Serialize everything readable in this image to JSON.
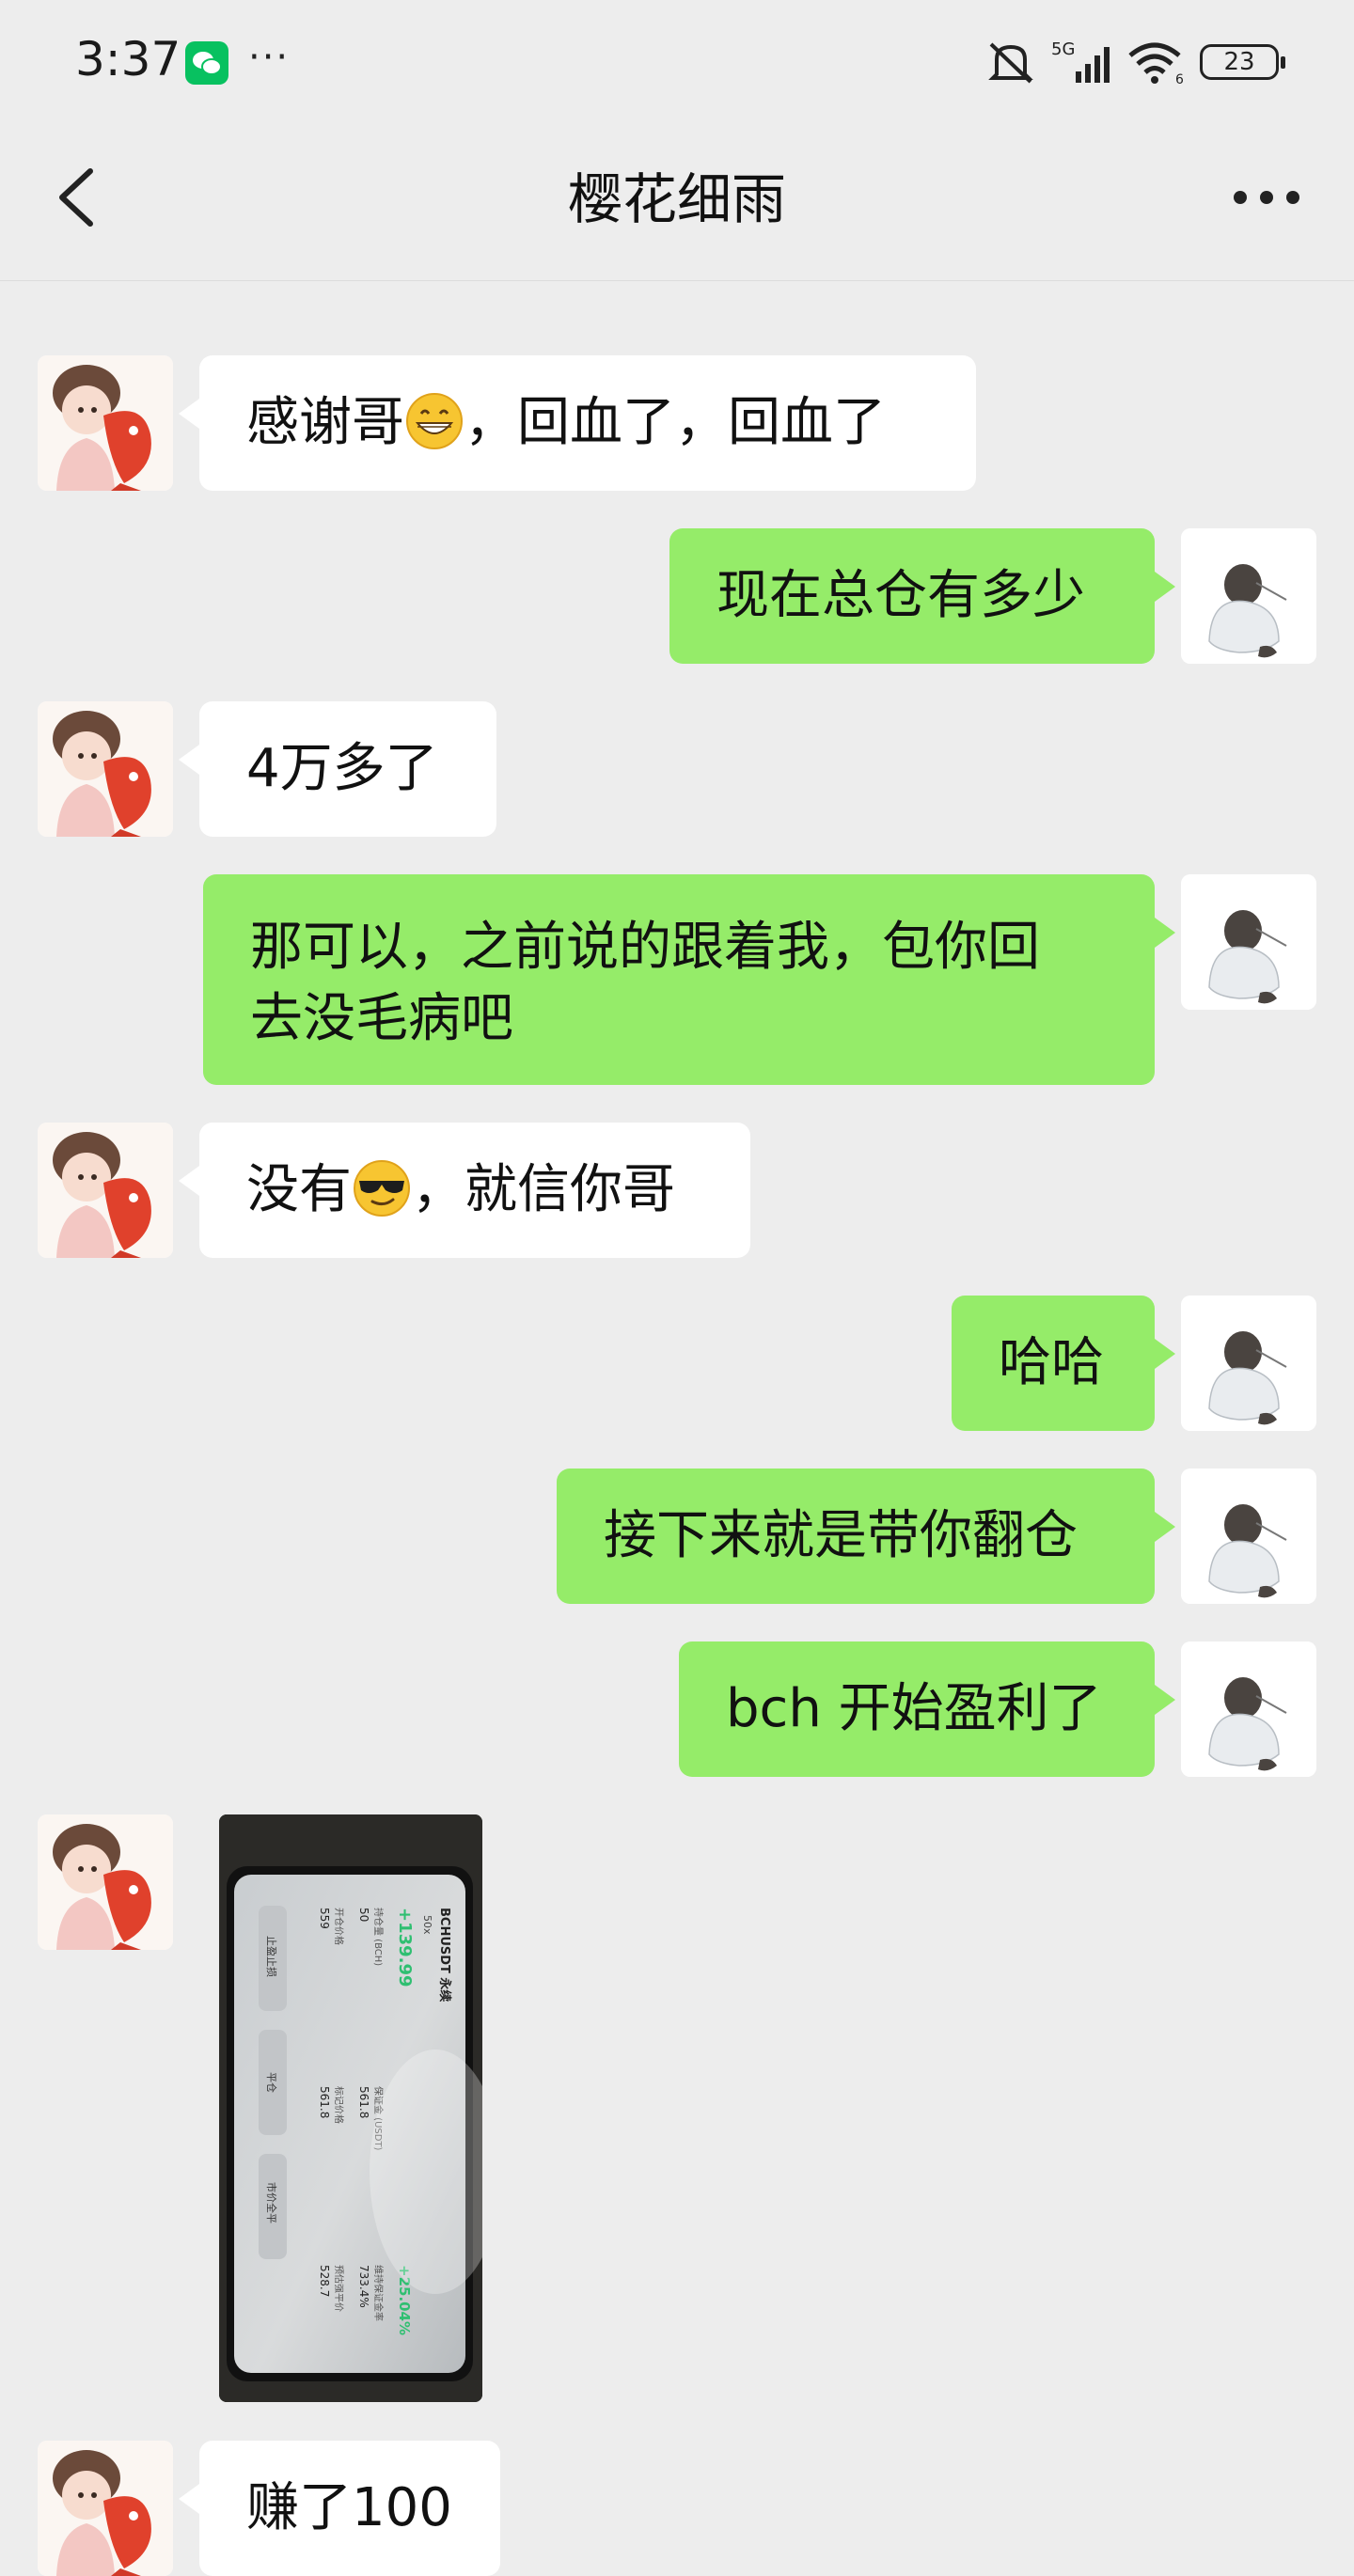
{
  "status": {
    "time": "3:37",
    "dots": "···",
    "network": "5G",
    "wifi_sub": "6",
    "battery": "23"
  },
  "header": {
    "title": "樱花细雨"
  },
  "messages": [
    {
      "side": "left",
      "text_a": "感谢哥",
      "text_b": "，回血了，回血了"
    },
    {
      "side": "right",
      "text": "现在总仓有多少"
    },
    {
      "side": "left",
      "text": "4万多了"
    },
    {
      "side": "right",
      "line1": "那可以，之前说的跟着我，包你回",
      "line2": "去没毛病吧"
    },
    {
      "side": "left",
      "text_a": "没有",
      "text_b": "，就信你哥"
    },
    {
      "side": "right",
      "text": "哈哈"
    },
    {
      "side": "right",
      "text": "接下来就是带你翻仓"
    },
    {
      "side": "right",
      "text": "bch 开始盈利了"
    },
    {
      "side": "left",
      "type": "image"
    },
    {
      "side": "left",
      "text": "赚了100"
    }
  ],
  "photo": {
    "pair": "BCHUSDT 永续",
    "tag": "50x",
    "pnl": "+139.99",
    "roe": "+25.04%",
    "size_label": "持仓量 (BCH)",
    "size": "50",
    "margin_label": "保证金 (USDT)",
    "margin": "561.8",
    "rate_label": "维持保证金率",
    "rate": "733.4%",
    "open_label": "开仓价格",
    "open": "559",
    "mark_label": "标记价格",
    "mark": "561.8",
    "liq_label": "预估强平价",
    "liq": "528.7",
    "btn1": "止盈止损",
    "btn2": "平仓",
    "btn3": "市价全平"
  },
  "colors": {
    "background": "#ededed",
    "self_bubble": "#95ec69",
    "other_bubble": "#ffffff",
    "wechat_green": "#08c160",
    "profit_green": "#2fbf71"
  }
}
